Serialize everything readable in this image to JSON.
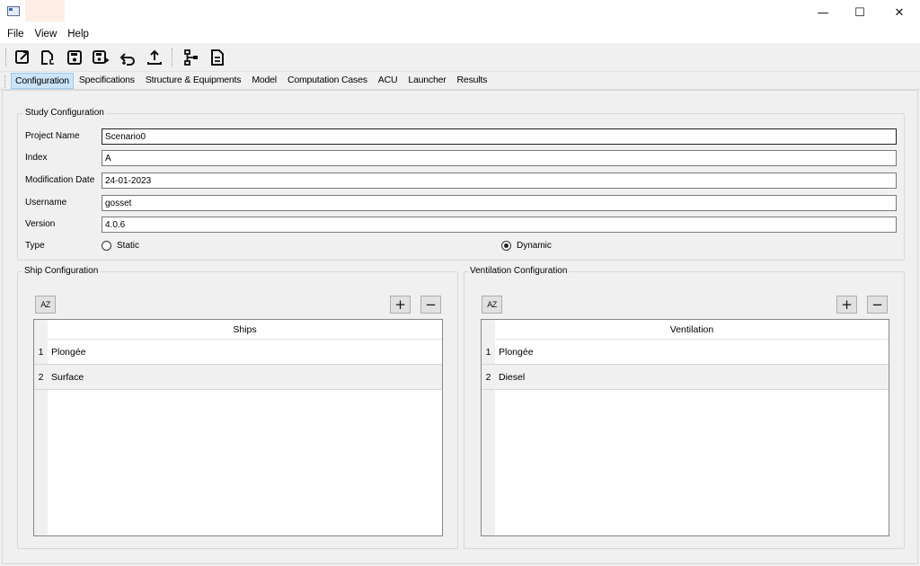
{
  "menu": [
    "File",
    "View",
    "Help"
  ],
  "toolbar": {
    "icons": [
      "open-external-icon",
      "new-file-icon",
      "save-icon",
      "save-as-icon",
      "import-icon",
      "upload-icon",
      "hierarchy-icon",
      "document-icon"
    ]
  },
  "tabs": [
    "Configuration",
    "Specifications",
    "Structure & Equipments",
    "Model",
    "Computation Cases",
    "ACU",
    "Launcher",
    "Results"
  ],
  "active_tab": "Configuration",
  "study": {
    "title": "Study Configuration",
    "project_name_label": "Project Name",
    "project_name": "Scenario0",
    "index_label": "Index",
    "index": "A",
    "modification_date_label": "Modification Date",
    "modification_date": "24-01-2023",
    "username_label": "Username",
    "username": "gosset",
    "version_label": "Version",
    "version": "4.0.6",
    "type_label": "Type",
    "type_static": "Static",
    "type_dynamic": "Dynamic",
    "selected_type": "Dynamic"
  },
  "ship": {
    "title": "Ship Configuration",
    "sort_label": "AZ",
    "add_label": "+",
    "remove_label": "−",
    "column": "Ships",
    "rows": [
      {
        "num": "1",
        "name": "Plongée"
      },
      {
        "num": "2",
        "name": "Surface"
      }
    ]
  },
  "ventilation": {
    "title": "Ventilation Configuration",
    "sort_label": "AZ",
    "add_label": "+",
    "remove_label": "−",
    "column": "Ventilation",
    "rows": [
      {
        "num": "1",
        "name": "Plongée"
      },
      {
        "num": "2",
        "name": "Diesel"
      }
    ]
  },
  "window": {
    "minimize": "—",
    "maximize": "☐",
    "close": "✕"
  }
}
